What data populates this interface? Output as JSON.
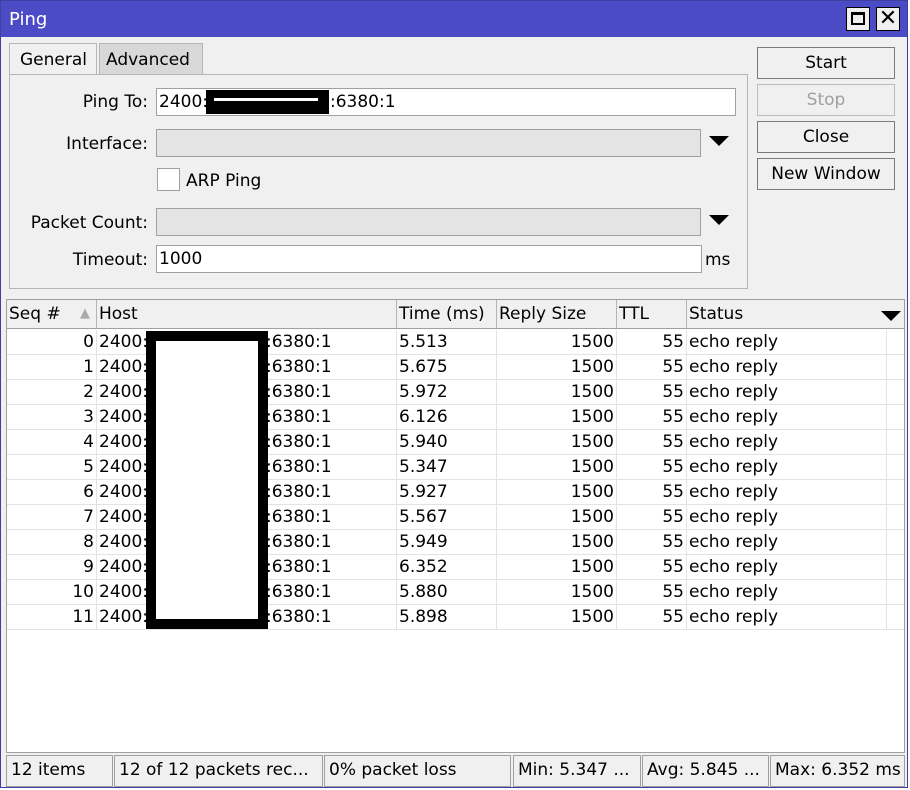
{
  "window": {
    "title": "Ping"
  },
  "tabs": {
    "general": "General",
    "advanced": "Advanced"
  },
  "form": {
    "ping_to_label": "Ping To:",
    "ping_to_prefix": "2400:",
    "ping_to_suffix": ":6380:1",
    "interface_label": "Interface:",
    "interface_value": "",
    "arp_ping_label": "ARP Ping",
    "packet_count_label": "Packet Count:",
    "packet_count_value": "",
    "timeout_label": "Timeout:",
    "timeout_value": "1000",
    "timeout_unit": "ms"
  },
  "buttons": {
    "start": "Start",
    "stop": "Stop",
    "close": "Close",
    "new_window": "New Window"
  },
  "table": {
    "columns": [
      "Seq #",
      "Host",
      "Time (ms)",
      "Reply Size",
      "TTL",
      "Status"
    ],
    "host_prefix": "2400:",
    "host_suffix": ":6380:1",
    "rows": [
      {
        "seq": "0",
        "time": "5.513",
        "size": "1500",
        "ttl": "55",
        "status": "echo reply"
      },
      {
        "seq": "1",
        "time": "5.675",
        "size": "1500",
        "ttl": "55",
        "status": "echo reply"
      },
      {
        "seq": "2",
        "time": "5.972",
        "size": "1500",
        "ttl": "55",
        "status": "echo reply"
      },
      {
        "seq": "3",
        "time": "6.126",
        "size": "1500",
        "ttl": "55",
        "status": "echo reply"
      },
      {
        "seq": "4",
        "time": "5.940",
        "size": "1500",
        "ttl": "55",
        "status": "echo reply"
      },
      {
        "seq": "5",
        "time": "5.347",
        "size": "1500",
        "ttl": "55",
        "status": "echo reply"
      },
      {
        "seq": "6",
        "time": "5.927",
        "size": "1500",
        "ttl": "55",
        "status": "echo reply"
      },
      {
        "seq": "7",
        "time": "5.567",
        "size": "1500",
        "ttl": "55",
        "status": "echo reply"
      },
      {
        "seq": "8",
        "time": "5.949",
        "size": "1500",
        "ttl": "55",
        "status": "echo reply"
      },
      {
        "seq": "9",
        "time": "6.352",
        "size": "1500",
        "ttl": "55",
        "status": "echo reply"
      },
      {
        "seq": "10",
        "time": "5.880",
        "size": "1500",
        "ttl": "55",
        "status": "echo reply"
      },
      {
        "seq": "11",
        "time": "5.898",
        "size": "1500",
        "ttl": "55",
        "status": "echo reply"
      }
    ]
  },
  "statusbar": {
    "items": "12 items",
    "received": "12 of 12 packets rec...",
    "loss": "0% packet loss",
    "min": "Min: 5.347 ...",
    "avg": "Avg: 5.845 ...",
    "max": "Max: 6.352 ms"
  }
}
